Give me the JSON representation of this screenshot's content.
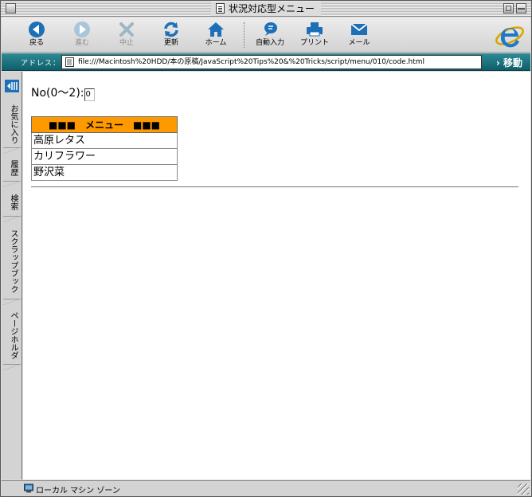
{
  "window": {
    "title": "状況対応型メニュー"
  },
  "toolbar": {
    "back": "戻る",
    "forward": "進む",
    "stop": "中止",
    "refresh": "更新",
    "home": "ホーム",
    "autofill": "自動入力",
    "print": "プリント",
    "mail": "メール"
  },
  "address": {
    "label": "アドレス：",
    "url": "file:///Macintosh%20HDD/本の原稿/JavaScript%20Tips%20&%20Tricks/script/menu/010/code.html",
    "go": "移動"
  },
  "sidebar": {
    "tabs": [
      "お気に入り",
      "履歴",
      "検索",
      "スクラップブック",
      "ページホルダ"
    ]
  },
  "page": {
    "prompt": "No(0〜2):",
    "input_value": "0",
    "menu_header": "■■■　メニュー　■■■",
    "menu_items": [
      "高原レタス",
      "カリフラワー",
      "野沢菜"
    ]
  },
  "status": {
    "zone": "ローカル マシン ゾーン"
  },
  "colors": {
    "menu_header_bg": "#ff9900",
    "address_bar_bg": "#1a7480"
  }
}
